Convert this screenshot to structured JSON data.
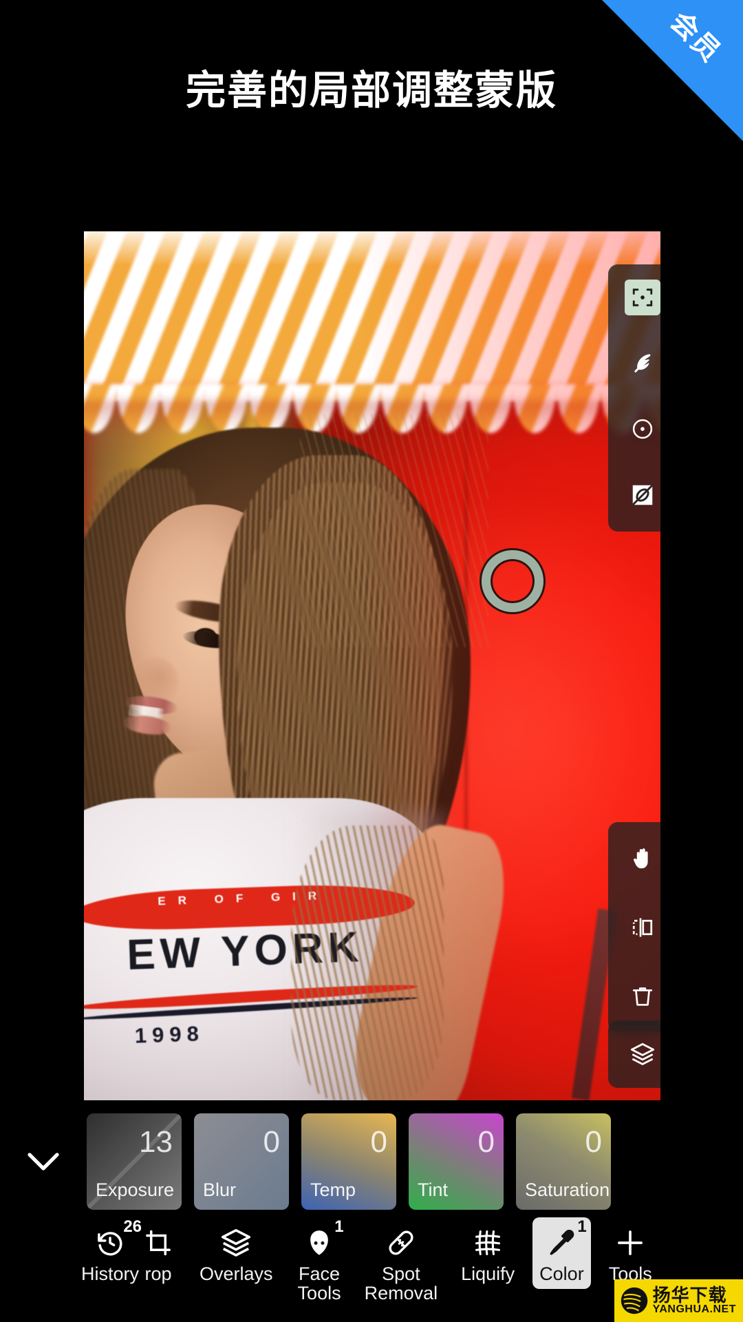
{
  "ribbon": {
    "label": "会员",
    "color": "#2d91f5"
  },
  "headline": {
    "text": "完善的局部调整蒙版"
  },
  "canvas": {
    "photo_description": "woman with long brown hair in white NEW YORK 1998 t-shirt in front of red wall with orange-white striped awning",
    "shirt_graphic": {
      "banner": "ER OF GIR",
      "main": "EW YORK",
      "year": "1998"
    },
    "selection_ring": {
      "name": "radial-mask-handle",
      "color": "#9eb2a4"
    }
  },
  "panel_top": {
    "items": [
      {
        "name": "target-select-icon",
        "selected": true
      },
      {
        "name": "feather-icon",
        "selected": false
      },
      {
        "name": "radial-mask-icon",
        "selected": false
      },
      {
        "name": "invert-mask-icon",
        "selected": false
      }
    ]
  },
  "panel_mid": {
    "items": [
      {
        "name": "pan-hand-icon",
        "selected": false
      },
      {
        "name": "mirror-flip-icon",
        "selected": false
      },
      {
        "name": "delete-trash-icon",
        "selected": false
      }
    ]
  },
  "panel_layers": {
    "items": [
      {
        "name": "layers-icon",
        "selected": false
      }
    ]
  },
  "adjustments": {
    "collapse_icon": "chevron-down-icon",
    "chips": [
      {
        "label": "Exposure",
        "value": "13",
        "style": "bg-exposure",
        "diagonal": true
      },
      {
        "label": "Blur",
        "value": "0",
        "style": "bg-blur",
        "diagonal": false
      },
      {
        "label": "Temp",
        "value": "0",
        "style": "bg-temp",
        "diagonal": false
      },
      {
        "label": "Tint",
        "value": "0",
        "style": "bg-tint",
        "diagonal": false
      },
      {
        "label": "Saturation",
        "value": "0",
        "style": "bg-sat",
        "diagonal": false
      }
    ]
  },
  "navbar": {
    "items": [
      {
        "label": "History",
        "icon": "history-undo-icon",
        "badge": "26",
        "active": false
      },
      {
        "label": "rop",
        "icon": "crop-icon",
        "badge": "",
        "active": false
      },
      {
        "label": "Overlays",
        "icon": "layers-icon",
        "badge": "",
        "active": false
      },
      {
        "label": "Face\nTools",
        "icon": "face-icon",
        "badge": "1",
        "active": false
      },
      {
        "label": "Spot\nRemoval",
        "icon": "bandage-icon",
        "badge": "",
        "active": false
      },
      {
        "label": "Liquify",
        "icon": "grid-mesh-icon",
        "badge": "",
        "active": false
      },
      {
        "label": "Color",
        "icon": "eyedropper-icon",
        "badge": "1",
        "active": true
      },
      {
        "label": "Tools",
        "icon": "plus-icon",
        "badge": "",
        "active": false
      }
    ]
  },
  "watermark": {
    "cn": "扬华下载",
    "en": "YANGHUA.NET"
  }
}
